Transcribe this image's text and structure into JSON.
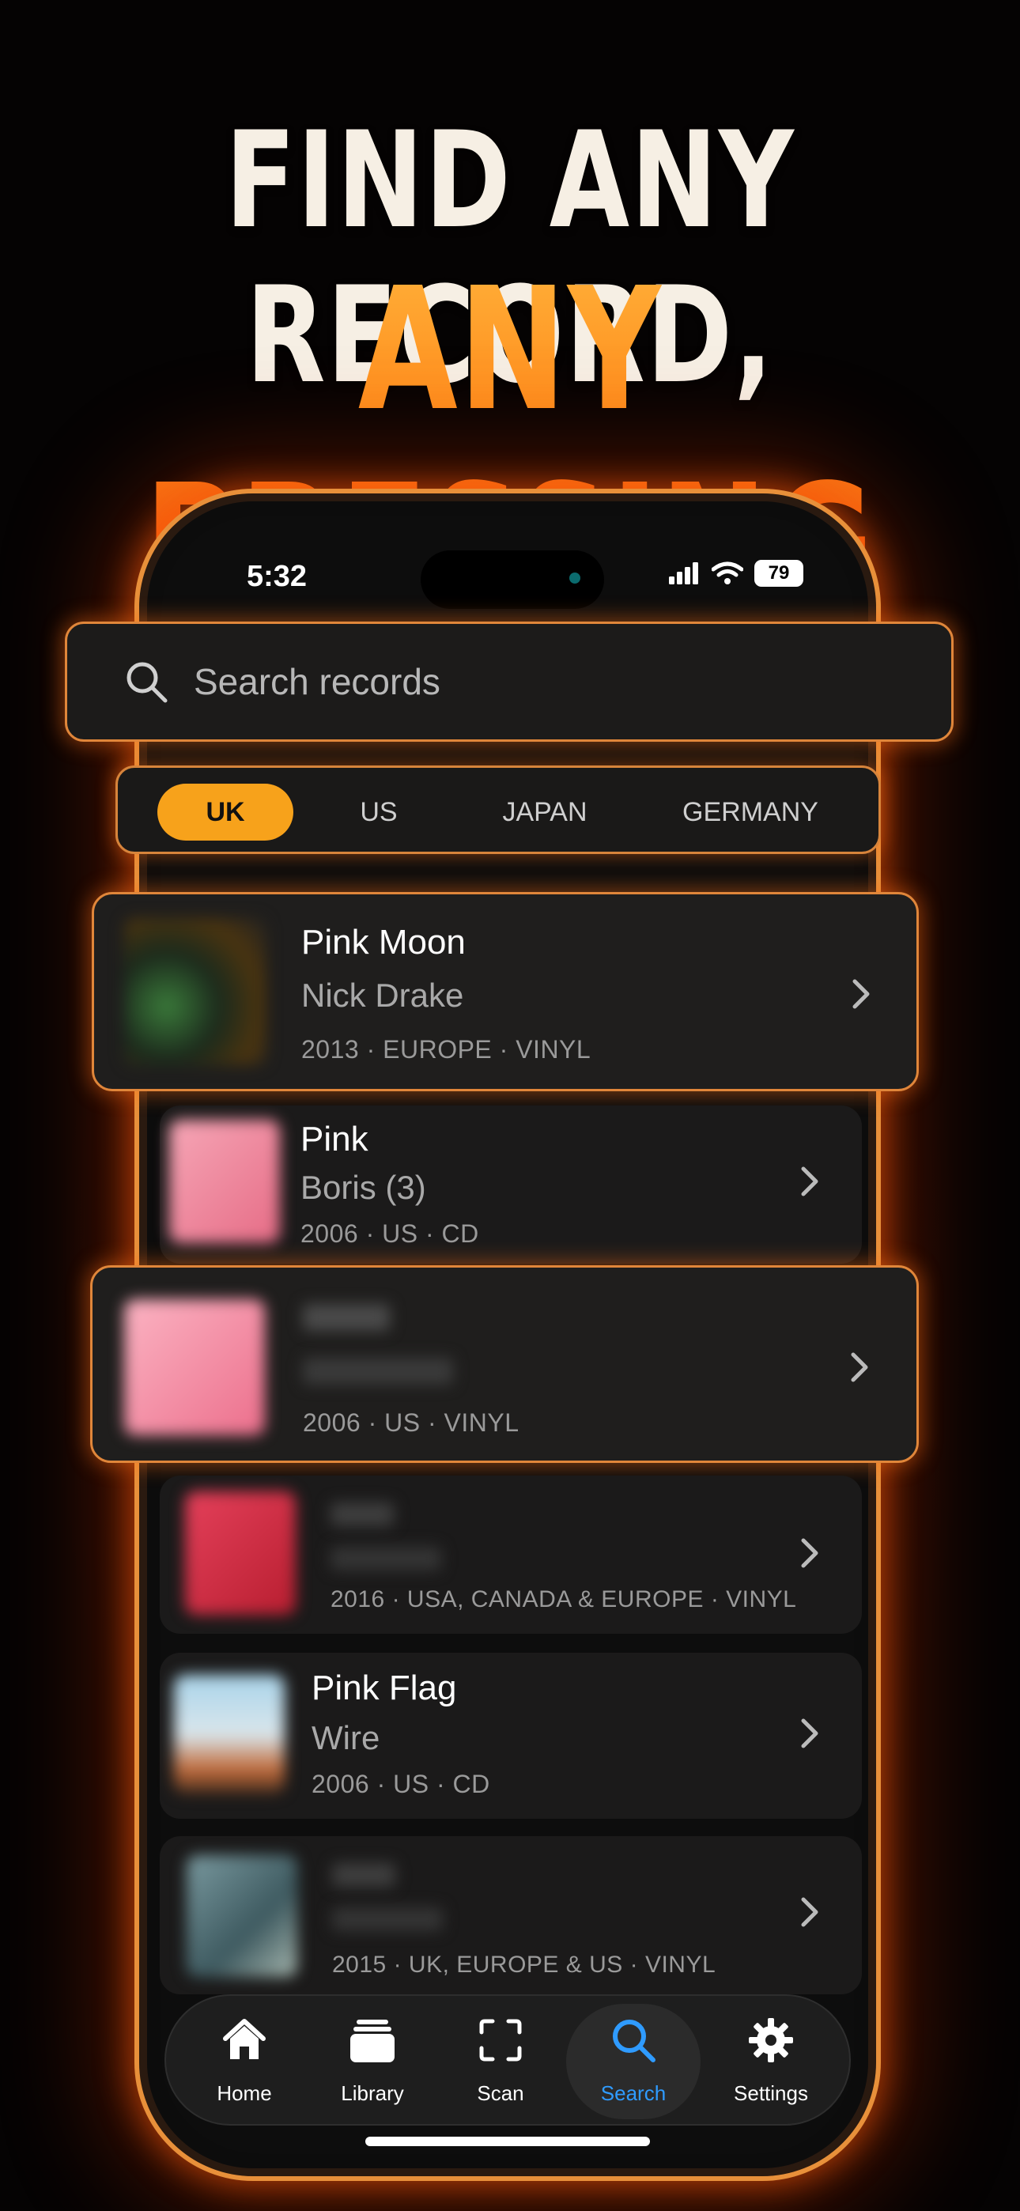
{
  "headline": {
    "line1": "FIND ANY RECORD,",
    "line2": "ANY PRESSING"
  },
  "status_bar": {
    "time": "5:32",
    "battery": "79"
  },
  "search": {
    "placeholder": "Search records"
  },
  "filters": {
    "tabs": [
      {
        "label": "UK",
        "active": true
      },
      {
        "label": "US",
        "active": false
      },
      {
        "label": "JAPAN",
        "active": false
      },
      {
        "label": "GERMANY",
        "active": false
      }
    ]
  },
  "results": [
    {
      "title": "Pink Moon",
      "artist": "Nick Drake",
      "meta": "2013 · EUROPE · VINYL",
      "highlighted": true
    },
    {
      "title": "Pink",
      "artist": "Boris (3)",
      "meta": "2006 · US · CD",
      "highlighted": false
    },
    {
      "title": "",
      "artist": "",
      "meta": "2006 · US · VINYL",
      "highlighted": true
    },
    {
      "title": "",
      "artist": "",
      "meta": "2016 · USA, CANADA & EUROPE · VINYL",
      "highlighted": false
    },
    {
      "title": "Pink Flag",
      "artist": "Wire",
      "meta": "2006 · US · CD",
      "highlighted": false
    },
    {
      "title": "",
      "artist": "",
      "meta": "2015 · UK, EUROPE & US · VINYL",
      "highlighted": false
    }
  ],
  "tab_bar": {
    "items": [
      {
        "label": "Home",
        "icon": "home-icon"
      },
      {
        "label": "Library",
        "icon": "library-icon"
      },
      {
        "label": "Scan",
        "icon": "scan-icon"
      },
      {
        "label": "Search",
        "icon": "search-icon",
        "active": true
      },
      {
        "label": "Settings",
        "icon": "gear-icon"
      }
    ]
  },
  "colors": {
    "accent": "#f7a21b",
    "glow": "#e0863a",
    "active_tab": "#2f9bff"
  }
}
